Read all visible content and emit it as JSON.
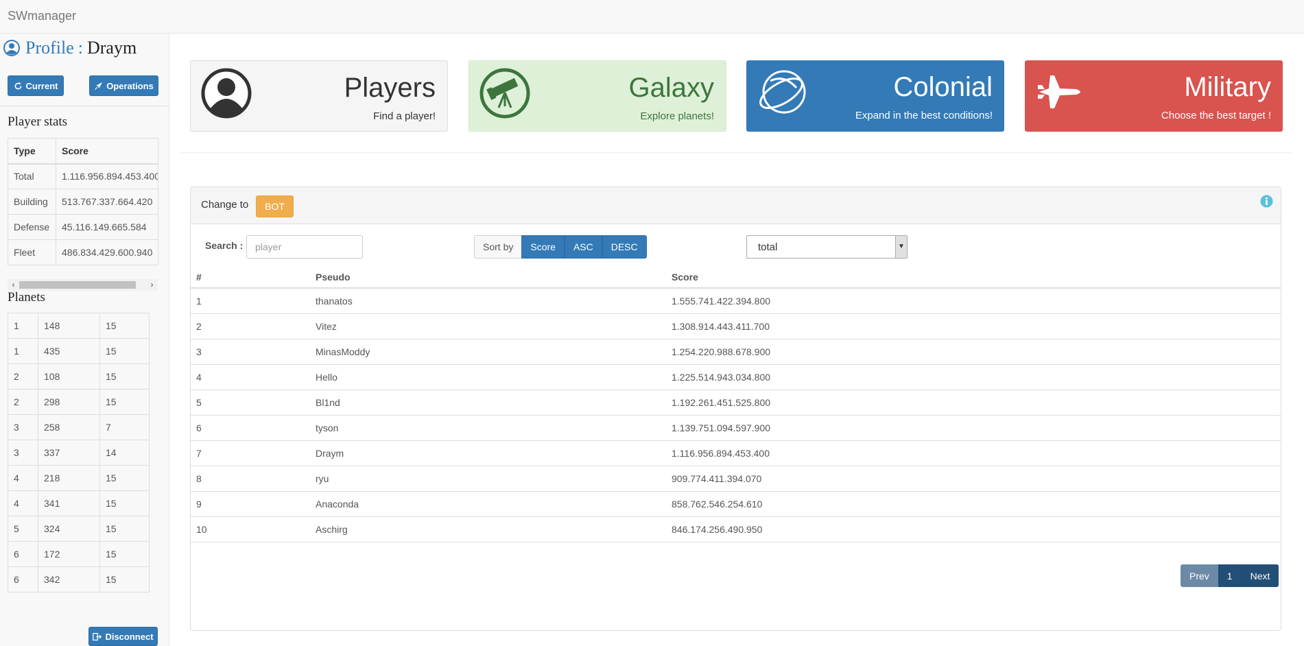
{
  "app": {
    "title": "SWmanager"
  },
  "sidebar": {
    "profile_label": "Profile",
    "separator": ":",
    "profile_name": "Draym",
    "current_label": "Current",
    "operations_label": "Operations",
    "player_stats_title": "Player stats",
    "stats_headers": [
      "Type",
      "Score"
    ],
    "stats_rows": [
      {
        "type": "Total",
        "score": "1.116.956.894.453.400"
      },
      {
        "type": "Building",
        "score": "513.767.337.664.420"
      },
      {
        "type": "Defense",
        "score": "45.116.149.665.584"
      },
      {
        "type": "Fleet",
        "score": "486.834.429.600.940"
      }
    ],
    "planets_title": "Planets",
    "planets": [
      [
        "1",
        "148",
        "15"
      ],
      [
        "1",
        "435",
        "15"
      ],
      [
        "2",
        "108",
        "15"
      ],
      [
        "2",
        "298",
        "15"
      ],
      [
        "3",
        "258",
        "7"
      ],
      [
        "3",
        "337",
        "14"
      ],
      [
        "4",
        "218",
        "15"
      ],
      [
        "4",
        "341",
        "15"
      ],
      [
        "5",
        "324",
        "15"
      ],
      [
        "6",
        "172",
        "15"
      ],
      [
        "6",
        "342",
        "15"
      ]
    ],
    "disconnect_label": "Disconnect"
  },
  "tiles": [
    {
      "title": "Players",
      "subtitle": "Find a player!",
      "bg": "#f5f5f5",
      "color": "#333333",
      "icon": "user-icon"
    },
    {
      "title": "Galaxy",
      "subtitle": "Explore planets!",
      "bg": "#dff0d8",
      "color": "#3c763d",
      "icon": "telescope-icon"
    },
    {
      "title": "Colonial",
      "subtitle": "Expand in the best conditions!",
      "bg": "#337ab7",
      "color": "#ffffff",
      "icon": "planet-orbit-icon"
    },
    {
      "title": "Military",
      "subtitle": "Choose the best target !",
      "bg": "#d9534f",
      "color": "#ffffff",
      "icon": "fighter-jet-icon"
    }
  ],
  "panel": {
    "change_to_label": "Change to",
    "bot_label": "BOT",
    "search_label": "Search :",
    "search_placeholder": "player",
    "sort_by_label": "Sort by",
    "sort_buttons": [
      "Score",
      "ASC",
      "DESC"
    ],
    "select_value": "total",
    "table_headers": [
      "#",
      "Pseudo",
      "Score"
    ],
    "rows": [
      {
        "rank": "1",
        "pseudo": "thanatos",
        "score": "1.555.741.422.394.800"
      },
      {
        "rank": "2",
        "pseudo": "Vitez",
        "score": "1.308.914.443.411.700"
      },
      {
        "rank": "3",
        "pseudo": "MinasModdy",
        "score": "1.254.220.988.678.900"
      },
      {
        "rank": "4",
        "pseudo": "Hello",
        "score": "1.225.514.943.034.800"
      },
      {
        "rank": "5",
        "pseudo": "Bl1nd",
        "score": "1.192.261.451.525.800"
      },
      {
        "rank": "6",
        "pseudo": "tyson",
        "score": "1.139.751.094.597.900"
      },
      {
        "rank": "7",
        "pseudo": "Draym",
        "score": "1.116.956.894.453.400"
      },
      {
        "rank": "8",
        "pseudo": "ryu",
        "score": "909.774.411.394.070"
      },
      {
        "rank": "9",
        "pseudo": "Anaconda",
        "score": "858.762.546.254.610"
      },
      {
        "rank": "10",
        "pseudo": "Aschirg",
        "score": "846.174.256.490.950"
      }
    ],
    "pager": {
      "prev": "Prev",
      "page": "1",
      "next": "Next"
    }
  },
  "colors": {
    "primary": "#337ab7",
    "warning": "#f0ad4e",
    "info": "#5bc0de"
  }
}
